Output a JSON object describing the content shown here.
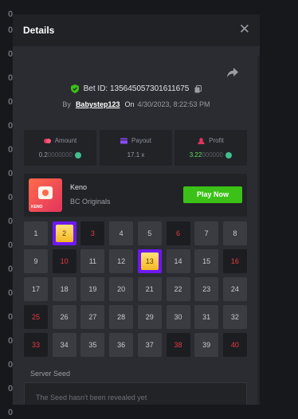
{
  "background_digits": [
    "0",
    "0",
    "0",
    "0",
    "0",
    "0",
    "0",
    "0",
    "0",
    "0",
    "0",
    "0",
    "0",
    "0",
    "0",
    "0",
    "0",
    "0",
    "0",
    "0"
  ],
  "modal": {
    "title": "Details",
    "close_icon": "close-icon",
    "share_icon": "share-icon"
  },
  "bet": {
    "id_label": "Bet ID: 135645057301611675",
    "by_label": "By",
    "username": "Babystep123",
    "on_label": "On",
    "timestamp": "4/30/2023, 8:22:53 PM"
  },
  "stats": {
    "amount": {
      "label": "Amount",
      "value_main": "0.2",
      "value_dim": "0000000"
    },
    "payout": {
      "label": "Payout",
      "value": "17.1 x"
    },
    "profit": {
      "label": "Profit",
      "value_main": "3.22",
      "value_dim": "000000"
    }
  },
  "game": {
    "name": "Keno",
    "provider": "BC Originals",
    "thumb_label": "KENO",
    "play_label": "Play Now"
  },
  "keno": {
    "numbers": [
      1,
      2,
      3,
      4,
      5,
      6,
      7,
      8,
      9,
      10,
      11,
      12,
      13,
      14,
      15,
      16,
      17,
      18,
      19,
      20,
      21,
      22,
      23,
      24,
      25,
      26,
      27,
      28,
      29,
      30,
      31,
      32,
      33,
      34,
      35,
      36,
      37,
      38,
      39,
      40
    ],
    "hits": [
      2,
      13
    ],
    "misses": [
      3,
      6,
      10,
      16,
      25,
      33,
      38,
      40
    ]
  },
  "seed": {
    "label": "Server Seed",
    "value": "The Seed hasn't been revealed yet"
  },
  "colors": {
    "accent_green": "#3bc117",
    "hit_purple": "#6d19f2",
    "miss_red": "#e8393f",
    "profit_green": "#5ee05a"
  }
}
